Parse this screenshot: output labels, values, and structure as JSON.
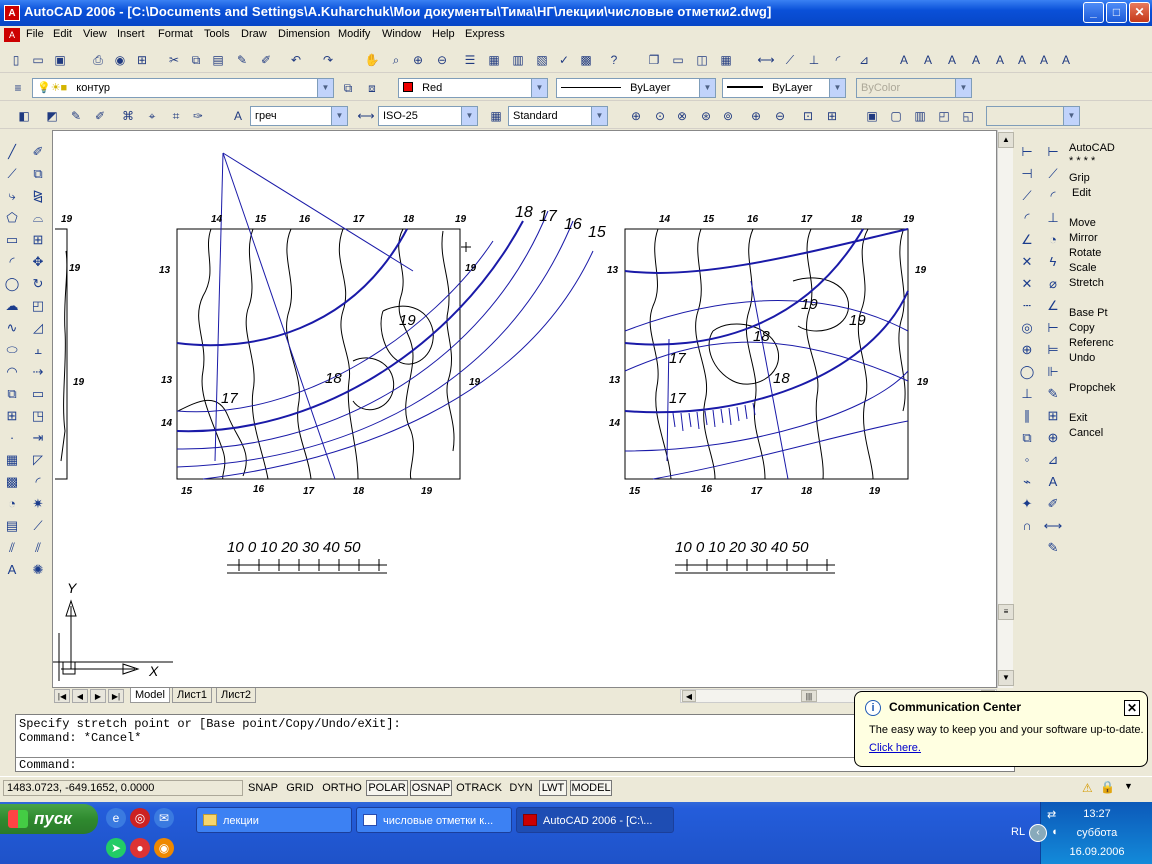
{
  "window": {
    "title": "AutoCAD 2006 - [C:\\Documents and Settings\\A.Kuharchuk\\Мои документы\\Тима\\НГ\\лекции\\числовые отметки2.dwg]"
  },
  "menu": [
    "File",
    "Edit",
    "View",
    "Insert",
    "Format",
    "Tools",
    "Draw",
    "Dimension",
    "Modify",
    "Window",
    "Help",
    "Express"
  ],
  "layers": {
    "layer_name": "контур",
    "color": "Red",
    "linetype": "ByLayer",
    "lineweight": "ByLayer",
    "plotstyle": "ByColor"
  },
  "styles": {
    "text_style": "греч",
    "dim_style": "ISO-25",
    "table_style": "Standard"
  },
  "screen_menu": [
    "AutoCAD",
    "* * * *",
    "Grip",
    "Edit",
    "Move",
    "Mirror",
    "Rotate",
    "Scale",
    "Stretch",
    "Base Pt",
    "Copy",
    "Referenc",
    "Undo",
    "Propchek",
    "Exit",
    "Cancel"
  ],
  "drawing": {
    "left_labels_top": [
      "14",
      "15",
      "16",
      "17",
      "18",
      "19"
    ],
    "left_labels_bottom": [
      "15",
      "16",
      "17",
      "18",
      "19"
    ],
    "left_side_labels": [
      "13",
      "13",
      "14"
    ],
    "left_right_labels": [
      "19",
      "19"
    ],
    "outer_arc_labels": [
      "18",
      "17",
      "16",
      "15"
    ],
    "left_inner_labels": [
      "19",
      "18",
      "17"
    ],
    "right_labels_top": [
      "14",
      "15",
      "16",
      "17",
      "18",
      "19"
    ],
    "right_labels_bottom": [
      "15",
      "16",
      "17",
      "18",
      "19"
    ],
    "right_side_labels": [
      "13",
      "13",
      "14"
    ],
    "right_right_labels": [
      "19",
      "19"
    ],
    "right_inner_labels": [
      "17",
      "18",
      "19",
      "17",
      "18",
      "19"
    ],
    "far_left_labels": [
      "19",
      "19",
      "19"
    ],
    "scale_text": "10  0   10 20 30 40  50",
    "ucs_x": "X",
    "ucs_y": "Y"
  },
  "tabs": [
    "Model",
    "Лист1",
    "Лист2"
  ],
  "command": {
    "line1": "Specify stretch point or [Base point/Copy/Undo/eXit]:",
    "line2": "Command: *Cancel*",
    "prompt": "Command:"
  },
  "status": {
    "coords": "1483.0723, -649.1652, 0.0000",
    "buttons": [
      "SNAP",
      "GRID",
      "ORTHO",
      "POLAR",
      "OSNAP",
      "OTRACK",
      "DYN",
      "LWT",
      "MODEL"
    ],
    "on": [
      "POLAR",
      "OSNAP",
      "LWT",
      "MODEL"
    ]
  },
  "balloon": {
    "title": "Communication Center",
    "body": "The easy way to keep you and your software up-to-date.",
    "link": "Click here."
  },
  "taskbar": {
    "start": "пуск",
    "tasks": [
      "лекции",
      "числовые отметки к...",
      "AutoCAD 2006 - [C:\\..."
    ],
    "lang": "RL",
    "time": "13:27",
    "day": "суббота",
    "date": "16.09.2006"
  }
}
